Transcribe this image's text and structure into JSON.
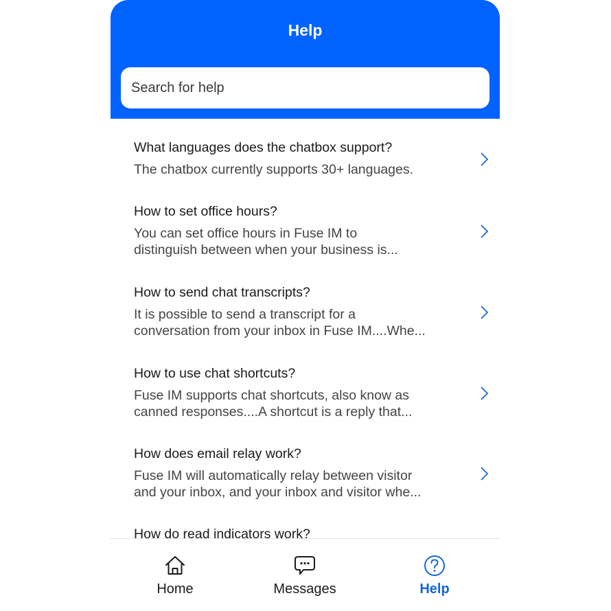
{
  "header": {
    "title": "Help",
    "accent_color": "#0062ff"
  },
  "search": {
    "placeholder": "Search for help",
    "value": ""
  },
  "articles": [
    {
      "title": "What languages does the chatbox support?",
      "desc_lines": [
        "The chatbox currently supports 30+ languages."
      ],
      "icon": "chevron-right-icon"
    },
    {
      "title": "How to set office hours?",
      "desc_lines": [
        "You can set office hours in Fuse IM to",
        "distinguish between when your business is..."
      ],
      "icon": "chevron-right-icon"
    },
    {
      "title": "How to send chat transcripts?",
      "desc_lines": [
        "It is possible to send a transcript for a",
        "conversation from your inbox in Fuse IM....Whe..."
      ],
      "icon": "chevron-right-icon"
    },
    {
      "title": "How to use chat shortcuts?",
      "desc_lines": [
        "Fuse IM supports chat shortcuts, also know as",
        "canned responses....A shortcut is a reply that..."
      ],
      "icon": "chevron-right-icon"
    },
    {
      "title": "How does email relay work?",
      "desc_lines": [
        "Fuse IM will automatically relay between visitor",
        "and your inbox, and your inbox and visitor whe..."
      ],
      "icon": "chevron-right-icon"
    },
    {
      "title": "How do read indicators work?",
      "desc_lines": [],
      "icon": "chevron-right-icon"
    }
  ],
  "tabbar": {
    "tabs": [
      {
        "label": "Home",
        "icon": "home-icon",
        "active": false
      },
      {
        "label": "Messages",
        "icon": "message-bubble-icon",
        "active": false
      },
      {
        "label": "Help",
        "icon": "question-circle-icon",
        "active": true
      }
    ],
    "active_color": "#1467d6"
  }
}
